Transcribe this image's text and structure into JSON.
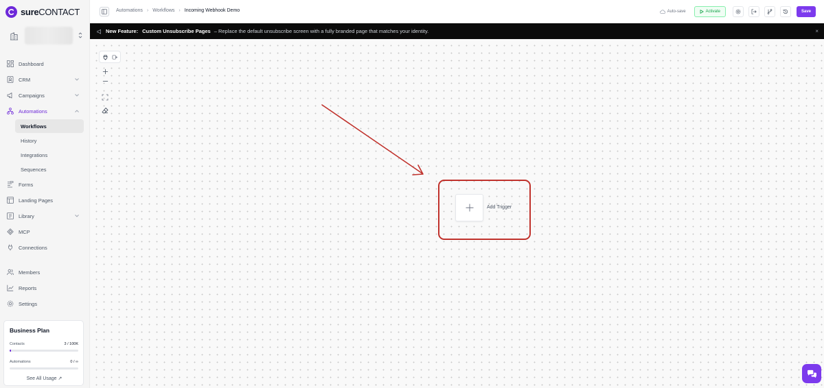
{
  "app": {
    "brand_bold": "sure",
    "brand_rest": "CONTACT",
    "accent_color": "#7c3aed"
  },
  "sidebar": {
    "items": [
      {
        "label": "Dashboard",
        "icon": "dashboard-icon"
      },
      {
        "label": "CRM",
        "icon": "contacts-icon",
        "has_chevron": true
      },
      {
        "label": "Campaigns",
        "icon": "megaphone-icon",
        "has_chevron": true
      },
      {
        "label": "Automations",
        "icon": "automation-icon",
        "active": true,
        "expanded": true
      },
      {
        "label": "Forms",
        "icon": "forms-icon"
      },
      {
        "label": "Landing Pages",
        "icon": "landing-page-icon"
      },
      {
        "label": "Library",
        "icon": "library-icon",
        "has_chevron": true
      },
      {
        "label": "MCP",
        "icon": "mcp-icon"
      },
      {
        "label": "Connections",
        "icon": "plug-icon"
      },
      {
        "label": "Members",
        "icon": "members-icon"
      },
      {
        "label": "Reports",
        "icon": "chart-icon"
      },
      {
        "label": "Settings",
        "icon": "gear-icon"
      }
    ],
    "automations_sub": [
      {
        "label": "Workflows",
        "current": true
      },
      {
        "label": "History"
      },
      {
        "label": "Integrations"
      },
      {
        "label": "Sequences"
      }
    ]
  },
  "plan": {
    "title": "Business Plan",
    "contacts_label": "Contacts",
    "contacts_value": "3 / 100K",
    "contacts_fraction": 3e-05,
    "automations_label": "Automations",
    "automations_value": "0 / ∞",
    "automations_fraction": 0,
    "link_label": "See All Usage ↗"
  },
  "header": {
    "breadcrumb": [
      "Automations",
      "Workflows",
      "Incoming Webhook Demo"
    ],
    "autosave_label": "Auto-save",
    "activate_label": "Activate",
    "save_label": "Save"
  },
  "banner": {
    "label": "New Feature:",
    "title": "Custom Unsubscribe Pages",
    "text": "– Replace the default unsubscribe screen with a fully branded page that matches your identity.",
    "close": "×"
  },
  "canvas": {
    "trigger_label": "Add Trigger",
    "highlight_color": "#c0312b"
  }
}
